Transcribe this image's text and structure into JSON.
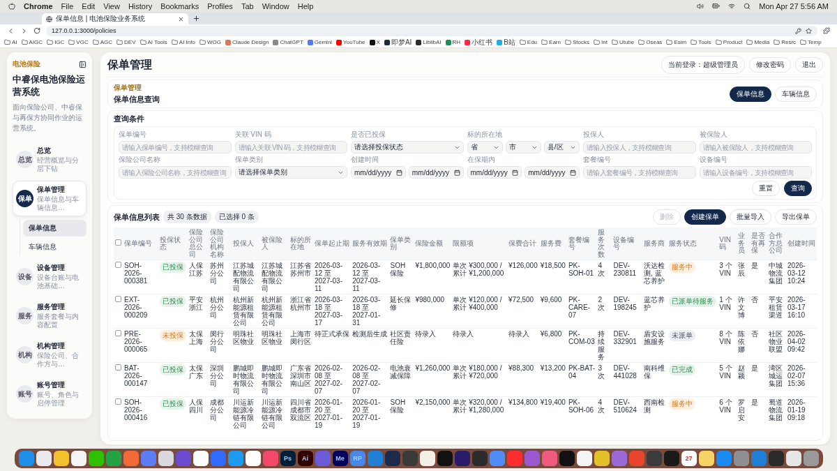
{
  "menu_bar": {
    "app": "Chrome",
    "items": [
      "File",
      "Edit",
      "View",
      "History",
      "Bookmarks",
      "Profiles",
      "Tab",
      "Window",
      "Help"
    ],
    "clock": "Mon Apr 27  5:56 AM"
  },
  "browser": {
    "tabs": [
      {
        "title": "保单信息 | 电池保险业务系统",
        "selected": true
      }
    ],
    "url": "127.0.0.1:3000/policies",
    "bookmarks": [
      {
        "label": "AI",
        "kind": "folder"
      },
      {
        "label": "AIGC",
        "kind": "folder"
      },
      {
        "label": "IGC",
        "kind": "folder"
      },
      {
        "label": "VGC",
        "kind": "folder"
      },
      {
        "label": "AGC",
        "kind": "folder"
      },
      {
        "label": "DEV",
        "kind": "folder"
      },
      {
        "label": "AI Tools",
        "kind": "folder"
      },
      {
        "label": "AI Info",
        "kind": "folder"
      },
      {
        "label": "WOG",
        "kind": "folder"
      },
      {
        "label": "Claude Design",
        "kind": "site",
        "color": "#d97757"
      },
      {
        "label": "ChatGPT",
        "kind": "site",
        "color": "#8a8a8a"
      },
      {
        "label": "Gemini",
        "kind": "site",
        "color": "#4f7df3"
      },
      {
        "label": "YouTube",
        "kind": "site",
        "color": "#ff0000"
      },
      {
        "label": "X",
        "kind": "site",
        "color": "#111111"
      },
      {
        "label": "即梦AI",
        "kind": "site",
        "color": "#1c2a3a"
      },
      {
        "label": "LiblibAI",
        "kind": "site",
        "color": "#2b2b2b"
      },
      {
        "label": "RH",
        "kind": "site",
        "color": "#1f8f5a"
      },
      {
        "label": "小红书",
        "kind": "site",
        "color": "#ff2442"
      },
      {
        "label": "B站",
        "kind": "site",
        "color": "#23ade5"
      },
      {
        "label": "Edu",
        "kind": "folder"
      },
      {
        "label": "Earn",
        "kind": "folder"
      },
      {
        "label": "Stocks",
        "kind": "folder"
      },
      {
        "label": "Int",
        "kind": "folder"
      },
      {
        "label": "Utube",
        "kind": "folder"
      },
      {
        "label": "Oseas",
        "kind": "folder"
      },
      {
        "label": "Esim",
        "kind": "folder"
      },
      {
        "label": "Tools",
        "kind": "folder"
      },
      {
        "label": "Product",
        "kind": "folder"
      },
      {
        "label": "Media",
        "kind": "folder"
      },
      {
        "label": "Resrc",
        "kind": "folder"
      },
      {
        "label": "Temp",
        "kind": "folder"
      }
    ]
  },
  "sidebar": {
    "brand": "电池保险",
    "title": "中睿保电池保险运营系统",
    "description": "面向保险公司、中睿保与再保方协同作业的运营系统。",
    "items": [
      {
        "badge": "总览",
        "title": "总览",
        "subtitle": "经营概览与分层下钻",
        "selected": false
      },
      {
        "badge": "保单",
        "title": "保单管理",
        "subtitle": "保单信息与车辆信息…",
        "selected": true,
        "children": [
          {
            "label": "保单信息",
            "selected": true
          },
          {
            "label": "车辆信息",
            "selected": false
          }
        ]
      },
      {
        "badge": "设备",
        "title": "设备管理",
        "subtitle": "设备台账与电池基础…",
        "selected": false
      },
      {
        "badge": "服务",
        "title": "服务管理",
        "subtitle": "服务套餐与内容配置",
        "selected": false
      },
      {
        "badge": "机构",
        "title": "机构管理",
        "subtitle": "保险公司、合作方与…",
        "selected": false
      },
      {
        "badge": "账号",
        "title": "账号管理",
        "subtitle": "账号、角色与启停管理",
        "selected": false
      }
    ]
  },
  "header": {
    "title": "保单管理",
    "user": "当前登录：超级管理员",
    "actions": [
      "修改密码",
      "退出"
    ]
  },
  "section": {
    "eyebrow": "保单管理",
    "title": "保单信息查询",
    "tabs": [
      {
        "label": "保单信息",
        "selected": true
      },
      {
        "label": "车辆信息",
        "selected": false
      }
    ]
  },
  "query": {
    "title": "查询条件",
    "fields": [
      {
        "label": "保单编号",
        "kind": "text",
        "placeholder": "请输入保单编号，支持模糊查询"
      },
      {
        "label": "关联 VIN 码",
        "kind": "text",
        "placeholder": "请输入关联 VIN 码，支持模糊查询"
      },
      {
        "label": "是否已投保",
        "kind": "select",
        "values": [
          "请选择投保状态"
        ]
      },
      {
        "label": "标的所在地",
        "kind": "select",
        "values": [
          "省",
          "市",
          "县/区"
        ]
      },
      {
        "label": "投保人",
        "kind": "text",
        "placeholder": "请输入投保人，支持模糊查询"
      },
      {
        "label": "被保险人",
        "kind": "text",
        "placeholder": "请输入被保险人，支持模糊查询"
      },
      {
        "label": "保险公司名称",
        "kind": "text",
        "placeholder": "请输入保险公司名称，支持模糊查询"
      },
      {
        "label": "保单类别",
        "kind": "select",
        "values": [
          "请选择保单类别"
        ]
      },
      {
        "label": "创建时间",
        "kind": "date",
        "values": [
          "mm/dd/yyyy",
          "mm/dd/yyyy"
        ]
      },
      {
        "label": "在保期内",
        "kind": "date",
        "values": [
          "mm/dd/yyyy",
          "mm/dd/yyyy"
        ]
      },
      {
        "label": "套餐编号",
        "kind": "text",
        "placeholder": "请输入套餐编号，支持模糊查询"
      },
      {
        "label": "设备编号",
        "kind": "text",
        "placeholder": "请输入设备编号，支持模糊查询"
      }
    ],
    "buttons": [
      {
        "label": "重置",
        "primary": false
      },
      {
        "label": "查询",
        "primary": true
      }
    ]
  },
  "list": {
    "title": "保单信息列表",
    "badges": [
      "共 30 条数据",
      "已选择 0 条"
    ],
    "buttons": [
      {
        "label": "删除",
        "primary": false,
        "disabled": true
      },
      {
        "label": "创建保单",
        "primary": true,
        "disabled": false
      },
      {
        "label": "批量导入",
        "primary": false,
        "disabled": false
      },
      {
        "label": "导出保单",
        "primary": false,
        "disabled": false
      }
    ],
    "select_all": {
      "checked": false
    },
    "columns": [
      "保单编号",
      "投保状态",
      "保险公司总公司",
      "保险公司机构名称",
      "投保人",
      "被保险人",
      "标的所在地",
      "保单起止期",
      "服务有效期",
      "保单类别",
      "保险金额",
      "限额项",
      "保费合计",
      "服务费",
      "套餐编号",
      "服务次数",
      "设备编号",
      "服务商",
      "服务状态",
      "VIN 码",
      "业务员",
      "是否有再保",
      "合作方总公司",
      "创建时间"
    ],
    "rows": [
      {
        "checked": false,
        "cells": [
          "SOH-2026-000381",
          {
            "text": "已投保",
            "kind": "insured"
          },
          "人保江苏",
          "苏州分公司",
          "江苏城配物流有限公司",
          "江苏城配物流有限公司",
          "江苏省苏州市",
          "2026-03-12 至 2027-03-11",
          "2026-03-12 至 2027-03-11",
          "SOH 保险",
          "¥1,800,000",
          "单次 ¥300,000 / 累计 ¥1,200,000",
          "¥126,000",
          "¥18,500",
          "PK-SOH-01",
          "4 次",
          "DEV-230811",
          "沃达检测, 蓝芯养护",
          {
            "text": "服务中",
            "kind": "in_service"
          },
          "3 个 VIN",
          "张辰",
          "是",
          "中城物流集团",
          "2026-03-12 10:24"
        ]
      },
      {
        "checked": false,
        "cells": [
          "EXT-2026-000209",
          {
            "text": "已投保",
            "kind": "insured"
          },
          "平安浙江",
          "杭州分公司",
          "杭州新能源租赁有限公司",
          "杭州新能源租赁有限公司",
          "浙江省杭州市",
          "2026-03-18 至 2027-03-17",
          "2026-03-18 至 2027-01-31",
          "延长保修",
          "¥980,000",
          "单次 ¥120,000 / 累计 ¥400,000",
          "¥72,500",
          "¥9,600",
          "PK-CARE-07",
          "2 次",
          "DEV-198245",
          "蓝芯养护",
          {
            "text": "已派单待服务",
            "kind": "dispatched"
          },
          "1 个 VIN",
          "许文博",
          "否",
          "平安租赁渠道",
          "2026-03-17 16:10"
        ]
      },
      {
        "checked": false,
        "cells": [
          "PRE-2026-000065",
          {
            "text": "未投保",
            "kind": "uninsured"
          },
          "太保上海",
          "闵行分公司",
          "明珠社区物业",
          "明珠社区物业",
          "上海市闵行区",
          "待正式承保",
          "检测后生成",
          "社区责任险",
          "待录入",
          "待录入",
          "待录入",
          "¥6,800",
          "PK-COM-03",
          "持续服务",
          "DEV-332901",
          "盾安设施服务",
          {
            "text": "未派单",
            "kind": "undispatched"
          },
          "8 个 VIN",
          "陈依娜",
          "否",
          "社区物业联盟",
          "2026-04-02 09:42"
        ]
      },
      {
        "checked": false,
        "cells": [
          "BAT-2026-000147",
          {
            "text": "已投保",
            "kind": "insured"
          },
          "太保广东",
          "深圳分公司",
          "鹏城即时物流有限公司",
          "鹏城即时物流有限公司",
          "广东省深圳市南山区",
          "2026-02-08 至 2027-02-07",
          "2026-02-08 至 2027-02-07",
          "电池衰减保障",
          "¥1,260,000",
          "单次 ¥180,000 / 累计 ¥720,000",
          "¥88,300",
          "¥13,200",
          "PK-BAT-04",
          "3 次",
          "DEV-441028",
          "南科维保",
          {
            "text": "已完成",
            "kind": "done"
          },
          "5 个 VIN",
          "赵颖",
          "是",
          "湾区城运集团",
          "2026-02-07 15:36"
        ]
      },
      {
        "checked": false,
        "cells": [
          "SOH-2026-000416",
          {
            "text": "已投保",
            "kind": "insured"
          },
          "人保四川",
          "成都分公司",
          "川运新能源冷链有限公司",
          "川运新能源冷链有限公司",
          "四川省成都市双流区",
          "2026-01-20 至 2027-01-19",
          "2026-01-20 至 2027-01-19",
          "SOH 保险",
          "¥2,150,000",
          "单次 ¥320,000 / 累计 ¥1,280,000",
          "¥134,800",
          "¥19,400",
          "PK-SOH-06",
          "4 次",
          "DEV-510624",
          "西南检测",
          {
            "text": "服务中",
            "kind": "in_service"
          },
          "6 个 VIN",
          "罗启安",
          "是",
          "蜀道物流集团",
          "2026-01-19 09:18"
        ]
      }
    ]
  },
  "dock": [
    {
      "color": "#1e8fe8"
    },
    {
      "color": "#e9e9ee"
    },
    {
      "color": "#f2c12e"
    },
    {
      "color": "#f4f4f4"
    },
    {
      "color": "#2dc100"
    },
    {
      "color": "#25a244"
    },
    {
      "color": "#f26a36"
    },
    {
      "color": "#5d7df5"
    },
    {
      "color": "#d8d8de"
    },
    {
      "color": "#6b4bd0"
    },
    {
      "color": "#ffffff"
    },
    {
      "color": "#2f6bff"
    },
    {
      "color": "#1d9bf0"
    },
    {
      "color": "#ffffff"
    },
    {
      "color": "#f5496b"
    },
    {
      "color": "#001e36",
      "label": "Ps"
    },
    {
      "color": "#330000",
      "label": "Ai"
    },
    {
      "color": "#6b5bd6"
    },
    {
      "color": "#00005b",
      "label": "Me"
    },
    {
      "color": "#4a88e8",
      "label": "RP"
    },
    {
      "color": "#1f7fd4"
    },
    {
      "color": "#1c2b4a"
    },
    {
      "color": "#3a3a3a"
    },
    {
      "color": "#f3efe6"
    },
    {
      "color": "#111111"
    },
    {
      "color": "#2b1b6b"
    },
    {
      "color": "#2c2c2c"
    },
    {
      "color": "#4f8cf7"
    },
    {
      "color": "#ff2d2d"
    },
    {
      "color": "#9b59d0"
    },
    {
      "color": "#f05a7e"
    },
    {
      "color": "#111111"
    },
    {
      "color": "#f4f4f4"
    },
    {
      "color": "#e4c02a"
    },
    {
      "color": "#9a6ad8"
    },
    {
      "color": "#e8452c"
    },
    {
      "color": "#3b3b3b"
    },
    {
      "color": "#1a1a1a"
    },
    {
      "color": "#ffffff",
      "label": "27"
    },
    {
      "color": "#f6d365"
    },
    {
      "color": "#1c8bf2"
    },
    {
      "color": "#8e8e93"
    },
    {
      "color": "#1f7fd4"
    },
    {
      "color": "#2a2a2a"
    },
    {
      "color": "#e6e6e6"
    },
    {
      "color": "#9a9a9a"
    }
  ]
}
